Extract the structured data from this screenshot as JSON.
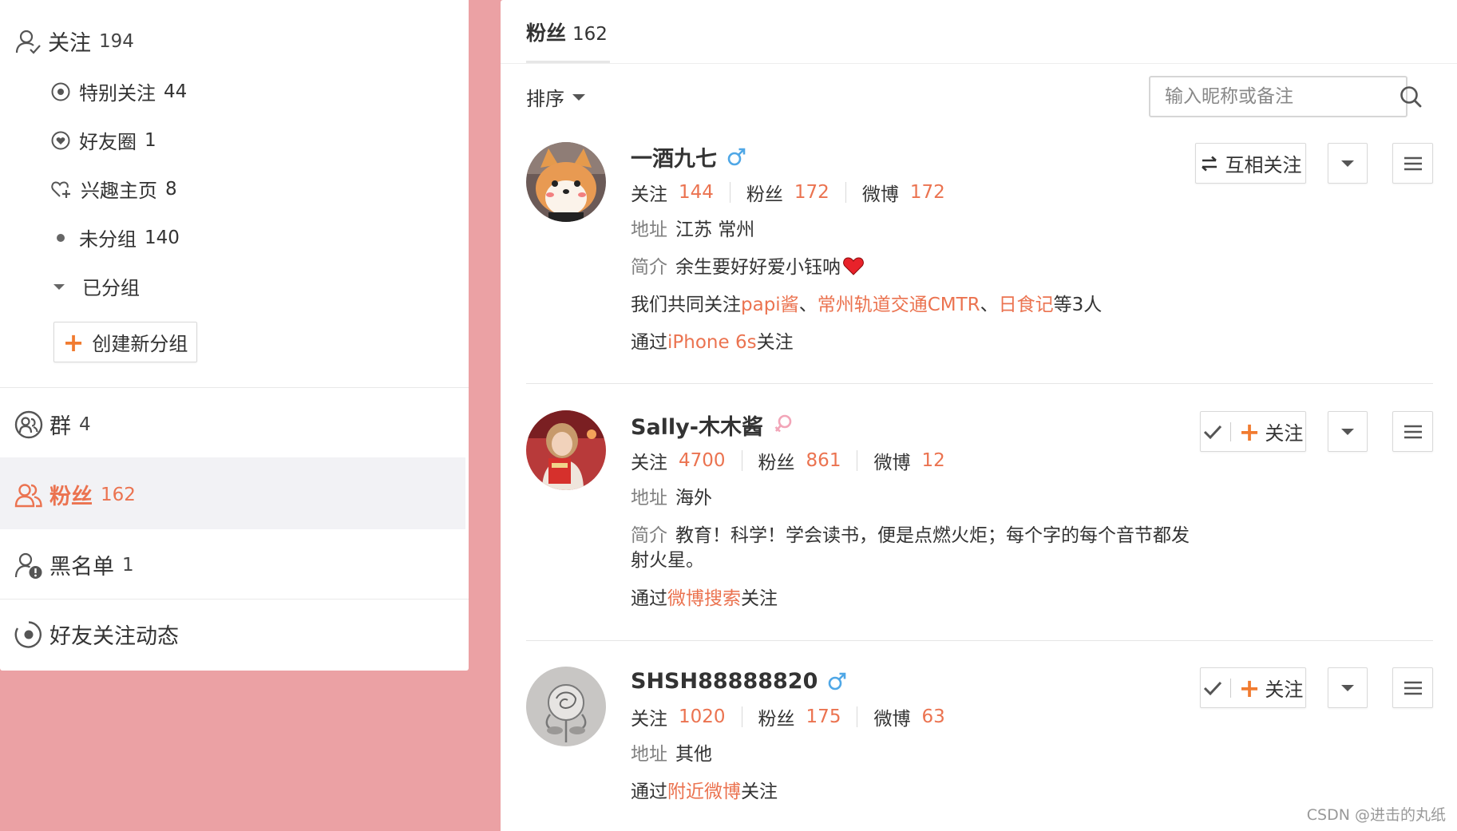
{
  "sidebar": {
    "follow": {
      "label": "关注",
      "count": "194"
    },
    "special": {
      "label": "特别关注",
      "count": "44"
    },
    "friends_circle": {
      "label": "好友圈",
      "count": "1"
    },
    "interest": {
      "label": "兴趣主页",
      "count": "8"
    },
    "ungrouped": {
      "label": "未分组",
      "count": "140"
    },
    "grouped": {
      "label": "已分组"
    },
    "create_group": {
      "label": "创建新分组"
    },
    "groups": {
      "label": "群",
      "count": "4"
    },
    "fans": {
      "label": "粉丝",
      "count": "162"
    },
    "blacklist": {
      "label": "黑名单",
      "count": "1"
    },
    "friends_activity": {
      "label": "好友关注动态"
    }
  },
  "main": {
    "tab": {
      "label": "粉丝",
      "count": "162"
    },
    "sort_label": "排序",
    "search": {
      "placeholder": "输入昵称或备注",
      "value": ""
    },
    "stat_labels": {
      "follow": "关注",
      "fans": "粉丝",
      "weibo": "微博"
    },
    "address_label": "地址",
    "intro_label": "简介",
    "via_prefix": "通过",
    "via_suffix": "关注",
    "fans_list": [
      {
        "name": "一酒九七",
        "gender": "male",
        "follow_count": "144",
        "fans_count": "172",
        "weibo_count": "172",
        "address": "江苏 常州",
        "intro": "余生要好好爱小钰呐",
        "common_prefix": "我们共同关注",
        "common_1": "papi酱",
        "common_sep_1": "、",
        "common_2": "常州轨道交通CMTR",
        "common_sep_2": "、",
        "common_3": "日食记",
        "common_suffix": "等3人",
        "via": "iPhone 6s",
        "action_label": "互相关注"
      },
      {
        "name": "Sally-木木酱",
        "gender": "female",
        "follow_count": "4700",
        "fans_count": "861",
        "weibo_count": "12",
        "address": "海外",
        "intro": "教育！科学！学会读书，便是点燃火炬；每个字的每个音节都发射火星。",
        "via": "微博搜索",
        "action_label": "关注"
      },
      {
        "name": "SHSH88888820",
        "gender": "male",
        "follow_count": "1020",
        "fans_count": "175",
        "weibo_count": "63",
        "address": "其他",
        "via": "附近微博",
        "action_label": "关注"
      }
    ]
  },
  "watermark": "CSDN @进击的丸纸",
  "colors": {
    "background": "#eba1a4",
    "accent": "#eb7350",
    "plus": "#f17b30",
    "male": "#4fa7e6",
    "female": "#f2a5b8",
    "heart": "#e8222a"
  }
}
